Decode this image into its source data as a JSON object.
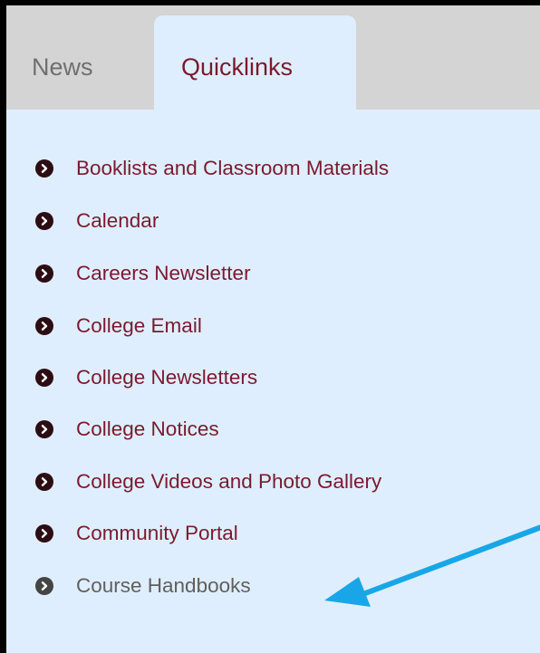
{
  "tabs": [
    {
      "label": "News",
      "active": false
    },
    {
      "label": "Quicklinks",
      "active": true
    }
  ],
  "quicklinks": [
    {
      "label": "Booklists and Classroom Materials"
    },
    {
      "label": "Calendar"
    },
    {
      "label": "Careers Newsletter"
    },
    {
      "label": "College Email"
    },
    {
      "label": "College Newsletters"
    },
    {
      "label": "College Notices"
    },
    {
      "label": "College Videos and Photo Gallery"
    },
    {
      "label": "Community Portal"
    },
    {
      "label": "Course Handbooks",
      "state": "hovered"
    }
  ],
  "colors": {
    "page_background": "#000000",
    "panel_background": "#dfeefe",
    "tabbar_background": "#d4d4d4",
    "link_color": "#7a1a30",
    "bullet_color": "#2c0d14",
    "inactive_tab_color": "#6f6f6f",
    "hovered_link_color": "#5f5f5f",
    "annotation_arrow_color": "#18a6e8"
  },
  "icons": {
    "bullet": "chevron-circle-right-icon",
    "annotation": "arrow-pointer-icon"
  }
}
